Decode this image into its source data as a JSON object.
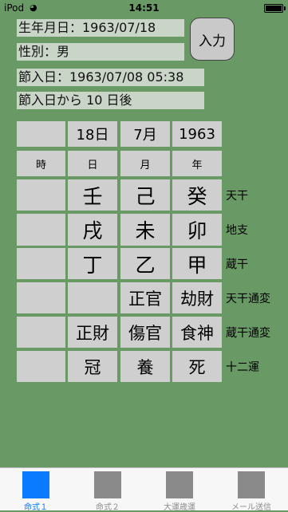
{
  "status_bar": {
    "carrier": "iPod",
    "wifi_icon": "wifi-icon",
    "time": "14:51",
    "battery_icon": "battery-icon"
  },
  "info": {
    "birth_date": "生年月日：1963/07/18",
    "gender": "性別：男",
    "setsu_date": "節入日：1963/07/08 05:38",
    "days_after": "節入日から 10 日後"
  },
  "input_button": "入力",
  "table": {
    "headers": [
      "",
      "18日",
      "7月",
      "1963"
    ],
    "subheaders": [
      "時",
      "日",
      "月",
      "年"
    ],
    "rows": [
      {
        "label": "天干",
        "cells": [
          "",
          "壬",
          "己",
          "癸"
        ]
      },
      {
        "label": "地支",
        "cells": [
          "",
          "戌",
          "未",
          "卯"
        ]
      },
      {
        "label": "蔵干",
        "cells": [
          "",
          "丁",
          "乙",
          "甲"
        ]
      },
      {
        "label": "天干通変",
        "cells": [
          "",
          "",
          "正官",
          "劫財"
        ]
      },
      {
        "label": "蔵干通変",
        "cells": [
          "",
          "正財",
          "傷官",
          "食神"
        ]
      },
      {
        "label": "十二運",
        "cells": [
          "",
          "冠",
          "養",
          "死"
        ]
      }
    ]
  },
  "tabs": [
    {
      "label": "命式１",
      "active": true
    },
    {
      "label": "命式２",
      "active": false
    },
    {
      "label": "大運歳運",
      "active": false
    },
    {
      "label": "メール送信",
      "active": false
    }
  ]
}
